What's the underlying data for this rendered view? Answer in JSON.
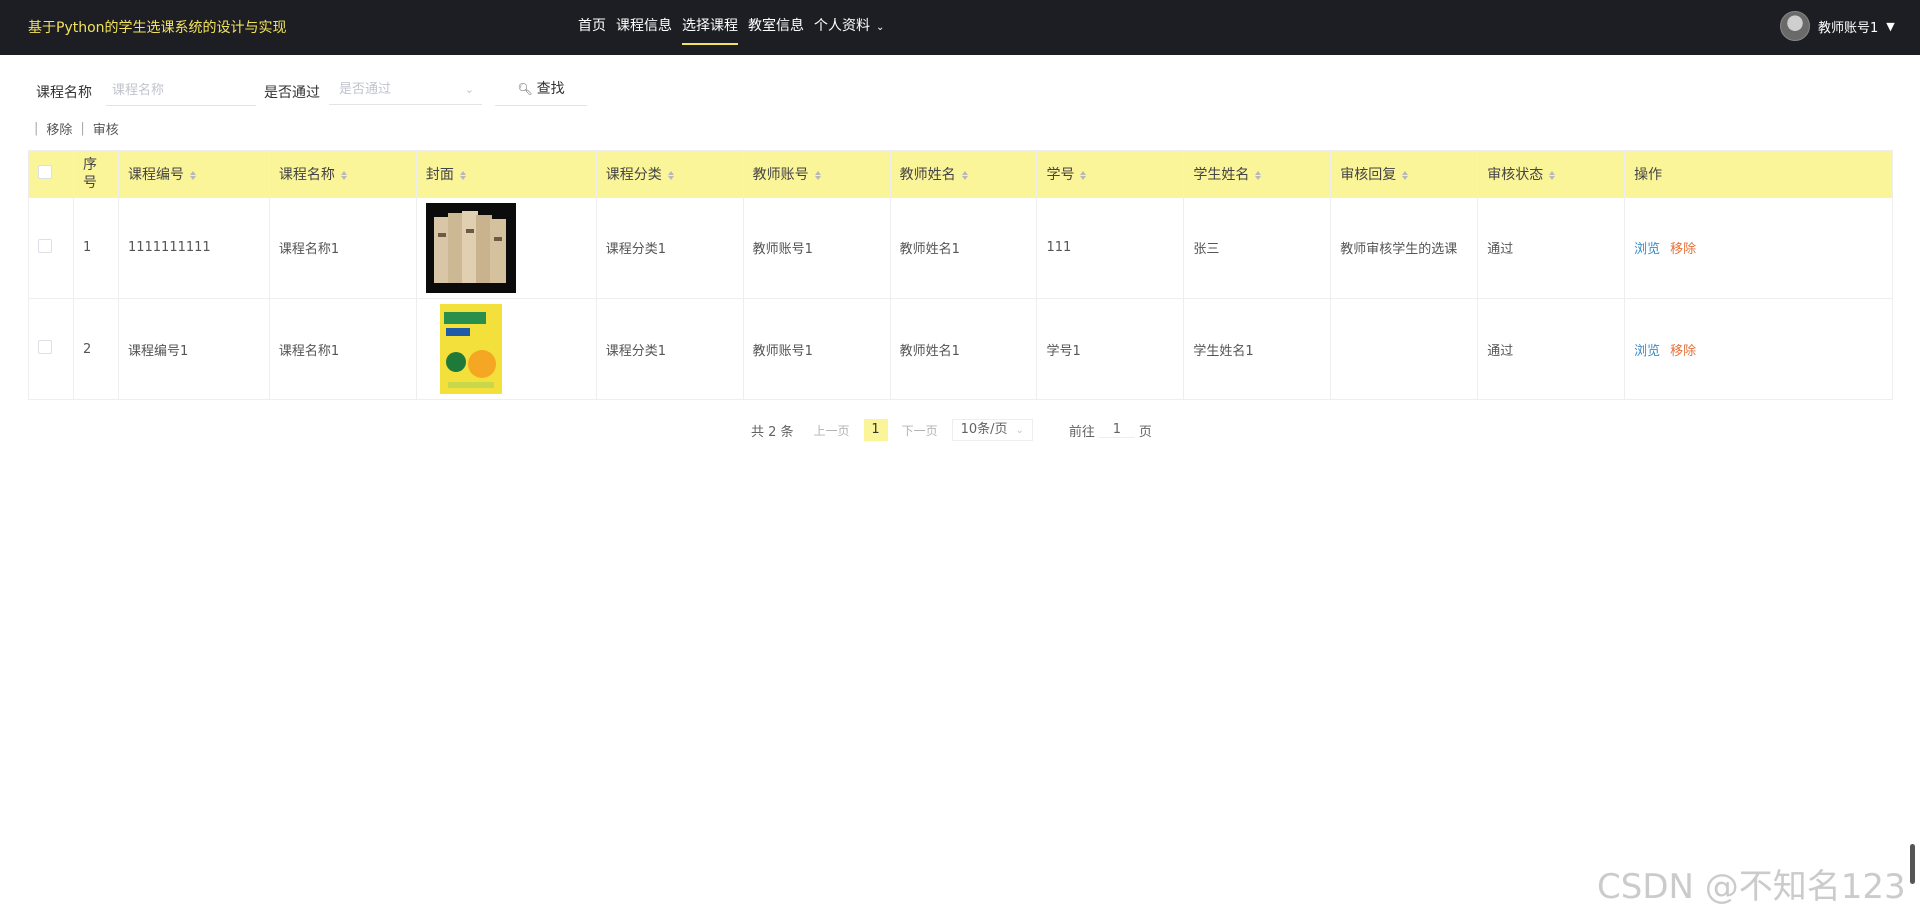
{
  "header": {
    "title": "基于Python的学生选课系统的设计与实现",
    "nav": [
      {
        "label": "首页"
      },
      {
        "label": "课程信息"
      },
      {
        "label": "选择课程"
      },
      {
        "label": "教室信息"
      },
      {
        "label": "个人资料"
      }
    ],
    "active_nav_color": "#f3e25c",
    "user_name": "教师账号1"
  },
  "search": {
    "course_name_label": "课程名称",
    "course_name_placeholder": "课程名称",
    "pass_label": "是否通过",
    "pass_placeholder": "是否通过",
    "search_button": "查找"
  },
  "actions": {
    "remove": "移除",
    "review": "审核"
  },
  "table": {
    "header_color": "#fbf59a",
    "columns": [
      "序号",
      "课程编号",
      "课程名称",
      "封面",
      "课程分类",
      "教师账号",
      "教师姓名",
      "学号",
      "学生姓名",
      "审核回复",
      "审核状态",
      "操作"
    ],
    "rows": [
      {
        "index": "1",
        "course_no": "1111111111",
        "course_name": "课程名称1",
        "cover": "book-stack-image",
        "category": "课程分类1",
        "teacher_account": "教师账号1",
        "teacher_name": "教师姓名1",
        "student_no": "111",
        "student_name": "张三",
        "review_reply": "教师审核学生的选课",
        "review_status": "通过",
        "view": "浏览",
        "remove": "移除"
      },
      {
        "index": "2",
        "course_no": "课程编号1",
        "course_name": "课程名称1",
        "cover": "yellow-textbook-image",
        "category": "课程分类1",
        "teacher_account": "教师账号1",
        "teacher_name": "教师姓名1",
        "student_no": "学号1",
        "student_name": "学生姓名1",
        "review_reply": "",
        "review_status": "通过",
        "view": "浏览",
        "remove": "移除"
      }
    ]
  },
  "pagination": {
    "total": "共 2 条",
    "prev": "上一页",
    "current": "1",
    "next": "下一页",
    "page_size": "10条/页",
    "goto_label": "前往",
    "goto_value": "1",
    "page_suffix": "页"
  },
  "watermark": "CSDN @不知名123"
}
